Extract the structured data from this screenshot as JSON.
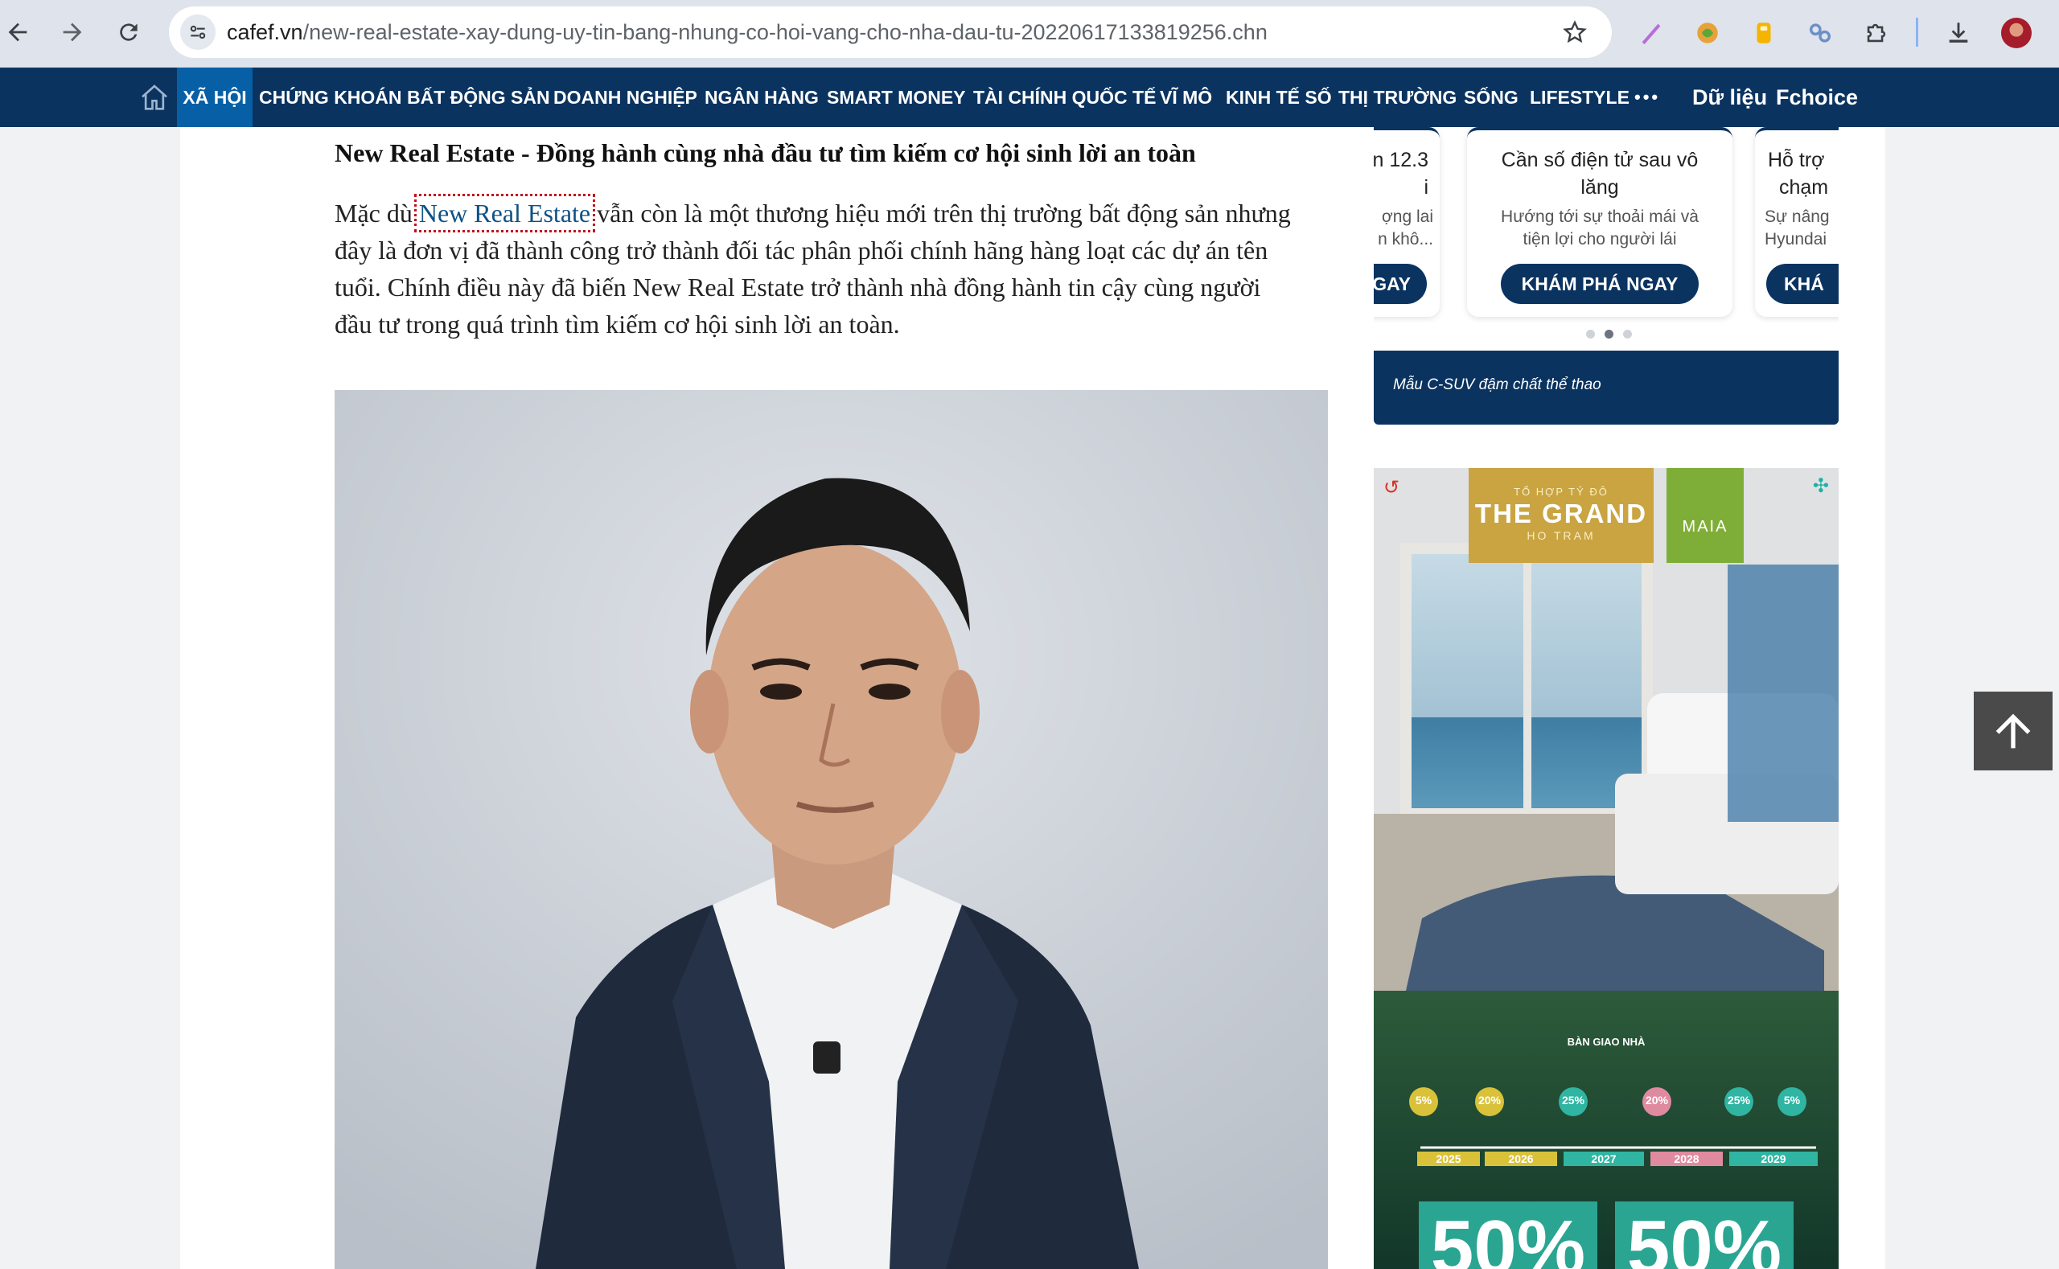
{
  "browser": {
    "url_domain": "cafef.vn",
    "url_path": "/new-real-estate-xay-dung-uy-tin-bang-nhung-co-hoi-vang-cho-nha-dau-tu-20220617133819256.chn"
  },
  "nav": {
    "items": [
      "XÃ HỘI",
      "CHỨNG KHOÁN",
      "BẤT ĐỘNG SẢN",
      "DOANH NGHIỆP",
      "NGÂN HÀNG",
      "SMART MONEY",
      "TÀI CHÍNH QUỐC TẾ",
      "VĨ MÔ",
      "KINH TẾ SỐ",
      "THỊ TRƯỜNG",
      "SỐNG",
      "LIFESTYLE"
    ],
    "more": "•••",
    "data_label": "Dữ liệu",
    "fchoice_label": "Fchoice"
  },
  "article": {
    "subheading": "New Real Estate - Đồng hành cùng nhà đầu tư tìm kiếm cơ hội sinh lời an toàn",
    "para_prefix": "Mặc dù ",
    "para_link": "New Real Estate",
    "para_line1_rest": " vẫn còn là một thương hiệu mới trên thị trường bất động sản nhưng",
    "para_line2": "đây là đơn vị đã thành công trở thành đối tác phân phối chính hãng hàng loạt các dự án tên",
    "para_line3": "tuổi. Chính điều này đã biến New Real Estate trở thành nhà đồng hành tin cậy cùng người",
    "para_line4": "đầu tư trong quá trình tìm kiếm cơ hội sinh lời an toàn."
  },
  "carousel": {
    "left_card": {
      "title_line1": "n 12.3",
      "title_line2": "i",
      "desc_line1": "ợng lai",
      "desc_line2": "n khô...",
      "button": "GAY"
    },
    "center_card": {
      "title_line1": "Cần số điện tử sau vô",
      "title_line2": "lăng",
      "desc_line1": "Hướng tới sự thoải mái và",
      "desc_line2": "tiện lợi cho người lái",
      "button": "KHÁM PHÁ NGAY"
    },
    "right_card": {
      "title_line1": "Hỗ trợ",
      "title_line2": "chạm",
      "desc_line1": "Sự nâng",
      "desc_line2": "Hyundai",
      "button": "KHÁ"
    },
    "promo_text": "Mẫu C-SUV đậm chất thể thao",
    "active_dot": 2
  },
  "ad": {
    "grand_top": "TỔ HỢP TỶ ĐÔ",
    "grand_title": "THE GRAND",
    "grand_sub": "HO TRAM",
    "maia": "MAIA",
    "timeline_title": "BÀN GIAO NHÀ",
    "timeline_badges": [
      "5%",
      "20%",
      "25%",
      "20%",
      "25%",
      "5%"
    ],
    "timeline_years": [
      "2025",
      "2026",
      "2027",
      "2028",
      "2029"
    ],
    "big_offer_1": "50%",
    "big_offer_2": "50%"
  },
  "icons": [
    "back-icon",
    "forward-icon",
    "reload-icon",
    "site-info-icon",
    "bookmark-star-icon",
    "pen-extension-icon",
    "leaf-extension-icon",
    "honey-extension-icon",
    "link-extension-icon",
    "puzzle-extensions-icon",
    "download-icon",
    "profile-avatar",
    "home-icon",
    "arrow-up-icon"
  ],
  "colors": {
    "nav_bg": "#0a3360",
    "nav_active": "#075fa6",
    "link": "#0e5186"
  }
}
